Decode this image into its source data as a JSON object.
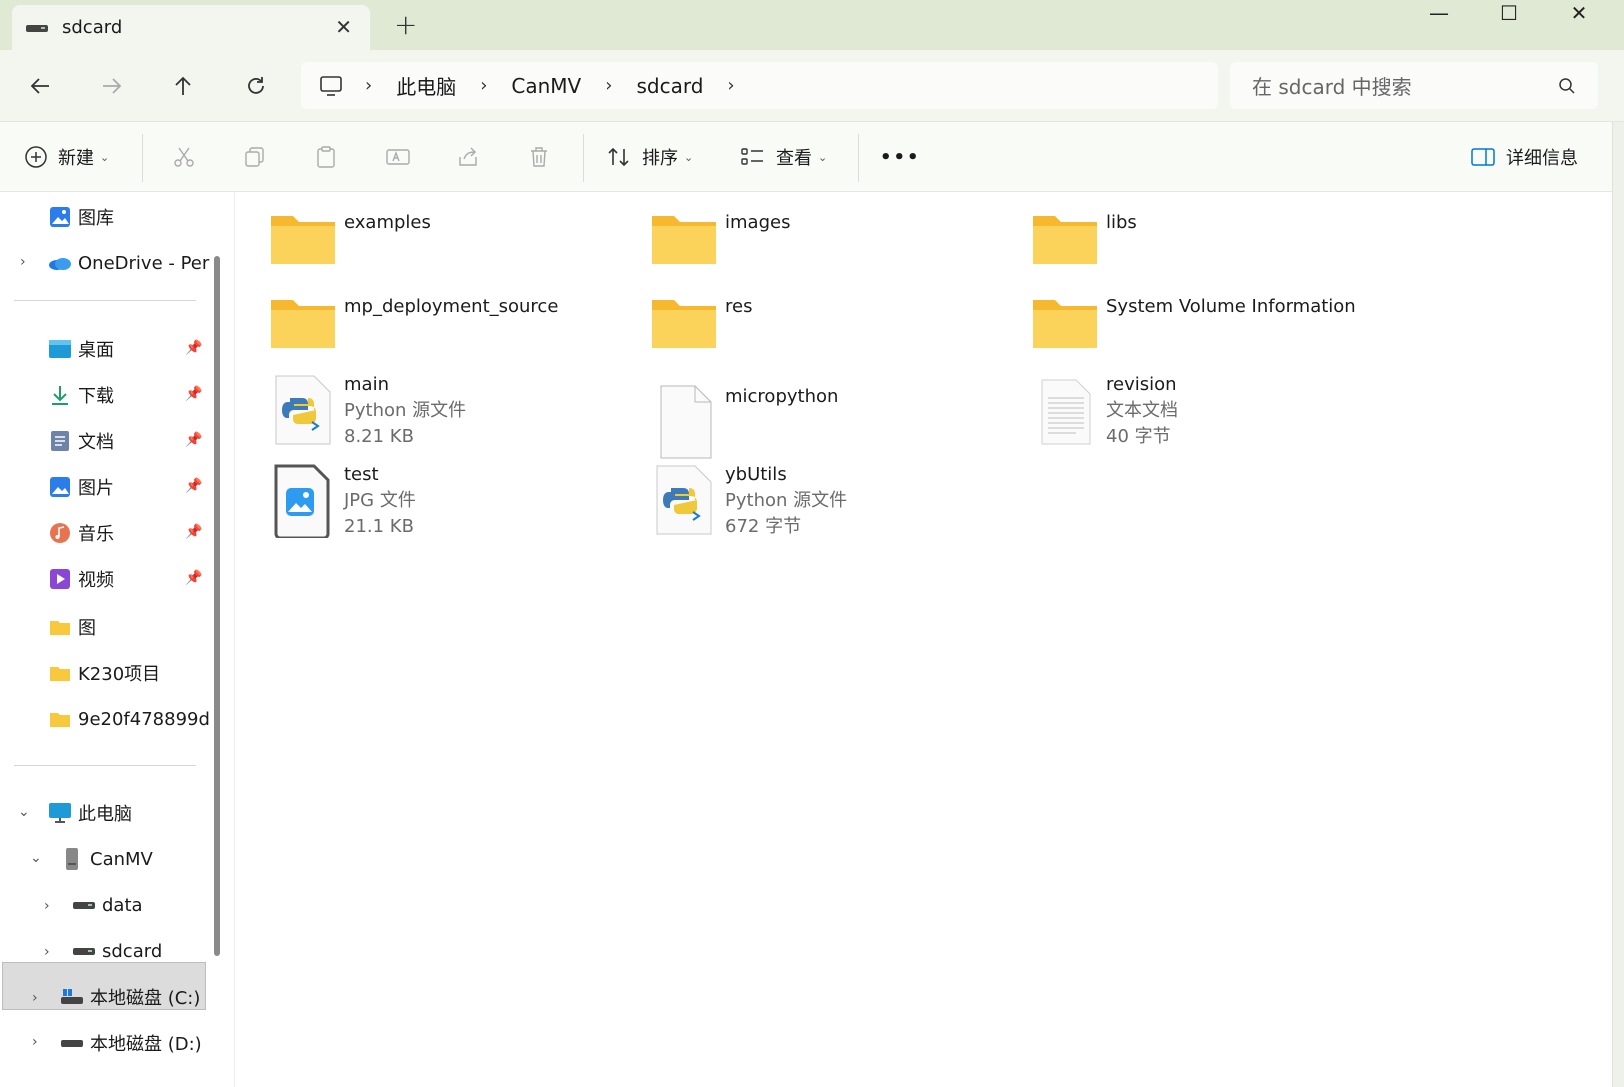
{
  "tab": {
    "title": "sdcard",
    "add": "+"
  },
  "window": {
    "minimize": "—",
    "maximize": "☐",
    "close": "✕"
  },
  "breadcrumb": [
    "此电脑",
    "CanMV",
    "sdcard"
  ],
  "search": {
    "placeholder": "在 sdcard 中搜索"
  },
  "toolbar": {
    "new_label": "新建",
    "sort_label": "排序",
    "view_label": "查看",
    "more_label": "•••",
    "details_label": "详细信息"
  },
  "sidebar": {
    "quick": [
      {
        "label": "图库",
        "icon": "gallery-icon"
      },
      {
        "label": "OneDrive - Per",
        "icon": "onedrive-icon"
      }
    ],
    "pinned": [
      {
        "label": "桌面",
        "icon": "desktop-icon"
      },
      {
        "label": "下载",
        "icon": "download-icon"
      },
      {
        "label": "文档",
        "icon": "document-icon"
      },
      {
        "label": "图片",
        "icon": "pictures-icon"
      },
      {
        "label": "音乐",
        "icon": "music-icon"
      },
      {
        "label": "视频",
        "icon": "video-icon"
      }
    ],
    "folders": [
      "图",
      "K230项目",
      "9e20f478899d"
    ],
    "tree": {
      "pc": "此电脑",
      "canmv": "CanMV",
      "data": "data",
      "sdcard": "sdcard",
      "c": "本地磁盘 (C:)",
      "d": "本地磁盘 (D:)"
    }
  },
  "files": {
    "folders": [
      "examples",
      "images",
      "libs",
      "mp_deployment_source",
      "res",
      "System Volume Information"
    ],
    "main": {
      "name": "main",
      "type": "Python 源文件",
      "size": "8.21 KB"
    },
    "micropython": {
      "name": "micropython"
    },
    "revision": {
      "name": "revision",
      "type": "文本文档",
      "size": "40 字节"
    },
    "test": {
      "name": "test",
      "type": "JPG 文件",
      "size": "21.1 KB"
    },
    "ybutils": {
      "name": "ybUtils",
      "type": "Python 源文件",
      "size": "672 字节"
    }
  },
  "colors": {
    "accent": "#0078d4",
    "folder": "#f8c93c",
    "chrome": "#dfe9d4"
  }
}
